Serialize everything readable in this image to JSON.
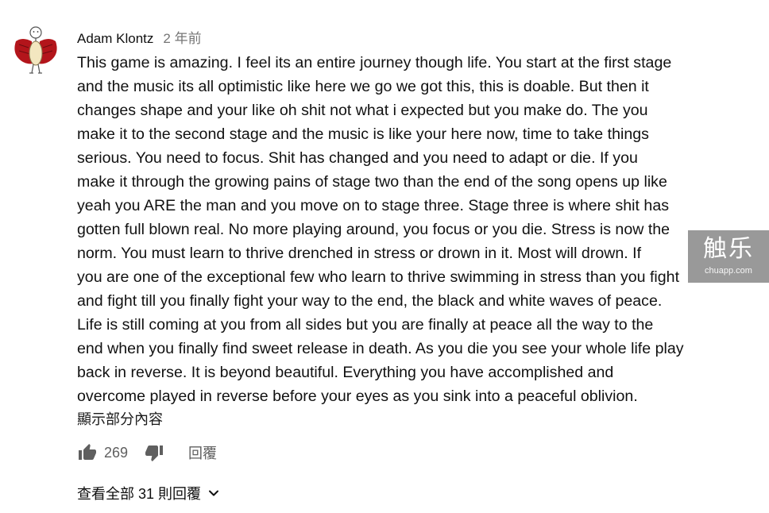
{
  "comment": {
    "author": "Adam Klontz",
    "timestamp": "2 年前",
    "lines": [
      "This game is amazing. I feel its an entire journey though life.  You start at the first stage",
      "and the music its all optimistic like here we go we got this, this is doable.  But then it",
      "changes shape and your like oh shit not what i expected but you make do.  The you",
      "make it to the second stage and the music is like your here now, time to take things",
      "serious.  You need to focus.  Shit has changed and you need to adapt or die.  If you",
      "make it through the growing pains of stage two than the end of the song opens up like",
      "yeah you ARE the man and you move on to stage three.  Stage three is where shit has",
      "gotten full blown real.  No more playing around, you focus or you die.  Stress is now the",
      "norm.  You must learn to thrive drenched in stress or drown in it.  Most will drown.  If",
      "you are one of the exceptional few who learn to thrive swimming in stress than you fight",
      "and fight till you finally fight your way to the end, the black and white waves of peace.",
      "Life is still coming at you from all sides but you are finally at peace all the way to the",
      "end when you finally find sweet release in death.  As you die you see your whole life play",
      "back in reverse.  It is beyond beautiful.  Everything you have accomplished and",
      "overcome played in reverse before your eyes as you sink into a peaceful oblivion."
    ],
    "show_more_label": "顯示部分內容",
    "like_count": "269",
    "reply_label": "回覆",
    "view_replies_label": "查看全部 31 則回覆"
  },
  "icons": {
    "avatar": "avatar-stick-figure-red-cape",
    "like": "thumbs-up-icon",
    "dislike": "thumbs-down-icon",
    "expand": "chevron-down-icon"
  },
  "watermark": {
    "main": "触乐",
    "sub": "chuapp.com"
  },
  "colors": {
    "text": "#0f0f0f",
    "secondary": "#5f5f5f",
    "timestamp": "#757575",
    "avatar_red": "#b3151b"
  }
}
